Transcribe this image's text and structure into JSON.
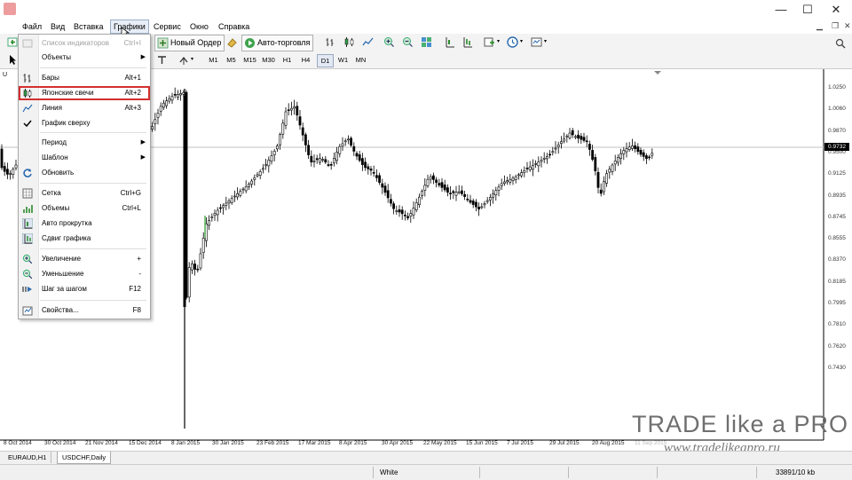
{
  "window": {
    "controls": {
      "minimize": "—",
      "maximize": "☐",
      "close": "✕"
    }
  },
  "menu": {
    "items": [
      "Файл",
      "Вид",
      "Вставка",
      "Графики",
      "Сервис",
      "Окно",
      "Справка"
    ],
    "open_index": 3
  },
  "toolbar": {
    "new_order": "Новый Ордер",
    "auto_trading": "Авто-торговля",
    "timeframes": [
      "M1",
      "M5",
      "M15",
      "M30",
      "H1",
      "H4",
      "D1",
      "W1",
      "MN"
    ],
    "selected_timeframe": "D1",
    "search_placeholder": ""
  },
  "dropdown": {
    "items": [
      {
        "label": "Список индикаторов",
        "shortcut": "Ctrl+I",
        "disabled": true,
        "icon": "indicator-list-icon"
      },
      {
        "label": "Объекты",
        "submenu": true,
        "icon": ""
      },
      {
        "label": "Бары",
        "shortcut": "Alt+1",
        "icon": "bars-icon"
      },
      {
        "label": "Японские свечи",
        "shortcut": "Alt+2",
        "icon": "candlesticks-icon",
        "highlight": true
      },
      {
        "label": "Линия",
        "shortcut": "Alt+3",
        "icon": "line-chart-icon"
      },
      {
        "label": "График сверху",
        "checked": true,
        "icon": "check-icon"
      },
      {
        "label": "Период",
        "submenu": true,
        "icon": ""
      },
      {
        "label": "Шаблон",
        "submenu": true,
        "icon": ""
      },
      {
        "label": "Обновить",
        "icon": "refresh-icon"
      },
      {
        "label": "Сетка",
        "shortcut": "Ctrl+G",
        "icon": "grid-icon"
      },
      {
        "label": "Объемы",
        "shortcut": "Ctrl+L",
        "icon": "volumes-icon"
      },
      {
        "label": "Авто прокрутка",
        "icon": "autoscroll-icon"
      },
      {
        "label": "Сдвиг графика",
        "icon": "chart-shift-icon"
      },
      {
        "label": "Увеличение",
        "shortcut": "+",
        "icon": "zoom-in-icon"
      },
      {
        "label": "Уменьшение",
        "shortcut": "-",
        "icon": "zoom-out-icon"
      },
      {
        "label": "Шаг за шагом",
        "shortcut": "F12",
        "icon": "step-icon"
      },
      {
        "label": "Свойства...",
        "shortcut": "F8",
        "icon": "properties-icon"
      }
    ]
  },
  "chart": {
    "symbol_label": "U",
    "price_ticks": [
      "1.0250",
      "1.0060",
      "0.9870",
      "0.9500",
      "0.9125",
      "0.8935",
      "0.8745",
      "0.8555",
      "0.8370",
      "0.8185",
      "0.7995",
      "0.7810",
      "0.7620",
      "0.7430"
    ],
    "current_price": "0.9732",
    "date_ticks": [
      "8 Oct 2014",
      "30 Oct 2014",
      "21 Nov 2014",
      "15 Dec 2014",
      "8 Jan 2015",
      "30 Jan 2015",
      "23 Feb 2015",
      "17 Mar 2015",
      "8 Apr 2015",
      "30 Apr 2015",
      "22 May 2015",
      "15 Jun 2015",
      "7 Jul 2015",
      "29 Jul 2015",
      "20 Aug 2015",
      "11 Sep 2015"
    ],
    "colors": {
      "candle": "#000000",
      "current_line": "#c0c0c0",
      "up_green": "#4caf50"
    }
  },
  "tabs": [
    {
      "label": "EURAUD,H1",
      "active": false
    },
    {
      "label": "USDCHF,Daily",
      "active": true
    }
  ],
  "status": {
    "profile": "White",
    "traffic": "33891/10 kb"
  },
  "watermark": {
    "title": "TRADE like a PRO",
    "url": "www.tradelikeapro.ru"
  }
}
